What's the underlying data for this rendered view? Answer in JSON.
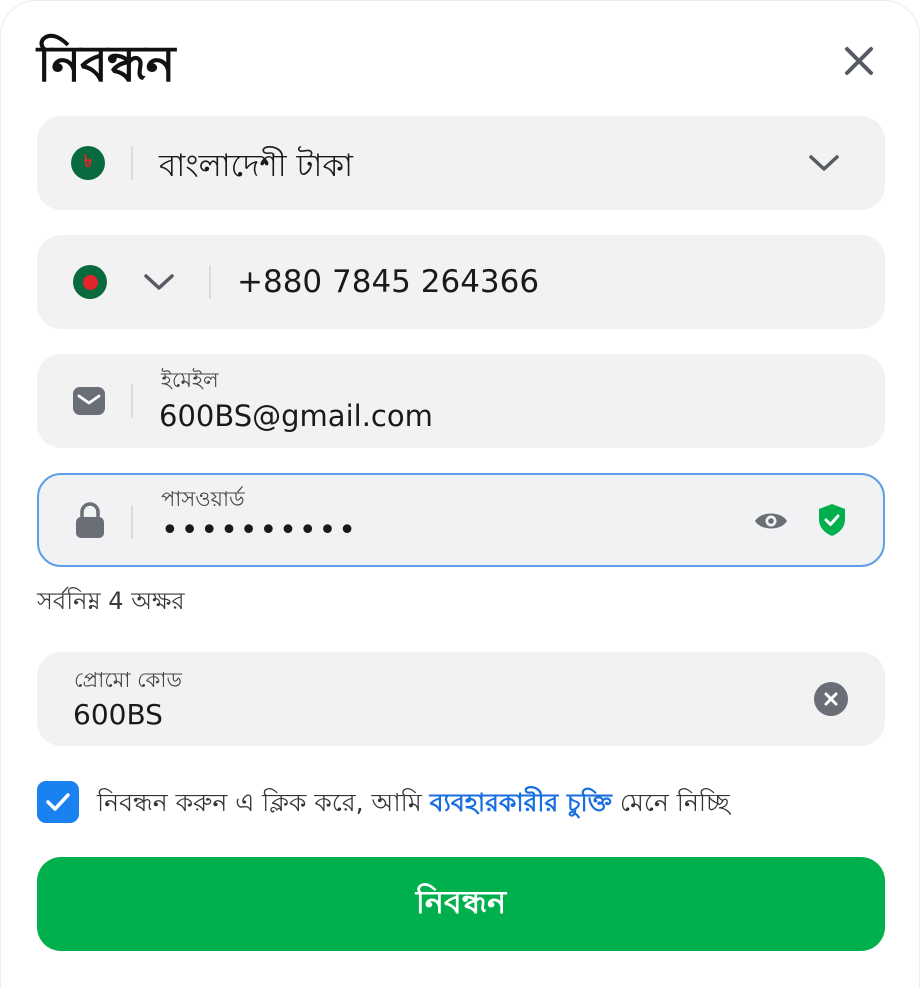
{
  "modal": {
    "title": "নিবন্ধন",
    "close_icon": "close-icon"
  },
  "currency": {
    "icon": "taka-flag-icon",
    "symbol": "৳",
    "value": "বাংলাদেশী টাকা",
    "dropdown_icon": "chevron-down-icon"
  },
  "phone": {
    "country_icon": "bangladesh-flag-icon",
    "dropdown_icon": "chevron-down-icon",
    "value": "+880 7845 264366"
  },
  "email": {
    "icon": "mail-icon",
    "label": "ইমেইল",
    "value": "600BS@gmail.com"
  },
  "password": {
    "icon": "lock-icon",
    "label": "পাসওয়ার্ড",
    "value": "••••••••••",
    "toggle_icon": "eye-icon",
    "status_icon": "shield-check-icon",
    "hint": "সর্বনিম্ন 4 অক্ষর"
  },
  "promo": {
    "label": "প্রোমো কোড",
    "value": "600BS",
    "clear_icon": "clear-circle-icon"
  },
  "agreement": {
    "checked": true,
    "text_before": "নিবন্ধন করুন এ ক্লিক করে, আমি ",
    "link": "ব্যবহারকারীর চুক্তি",
    "text_after": " মেনে নিচ্ছি"
  },
  "submit": {
    "label": "নিবন্ধন"
  },
  "colors": {
    "accent_green": "#00b04c",
    "link_blue": "#1a6fe0",
    "checkbox_blue": "#1a82f0",
    "focus_border": "#5aa0ea",
    "field_bg": "#f2f2f3"
  }
}
